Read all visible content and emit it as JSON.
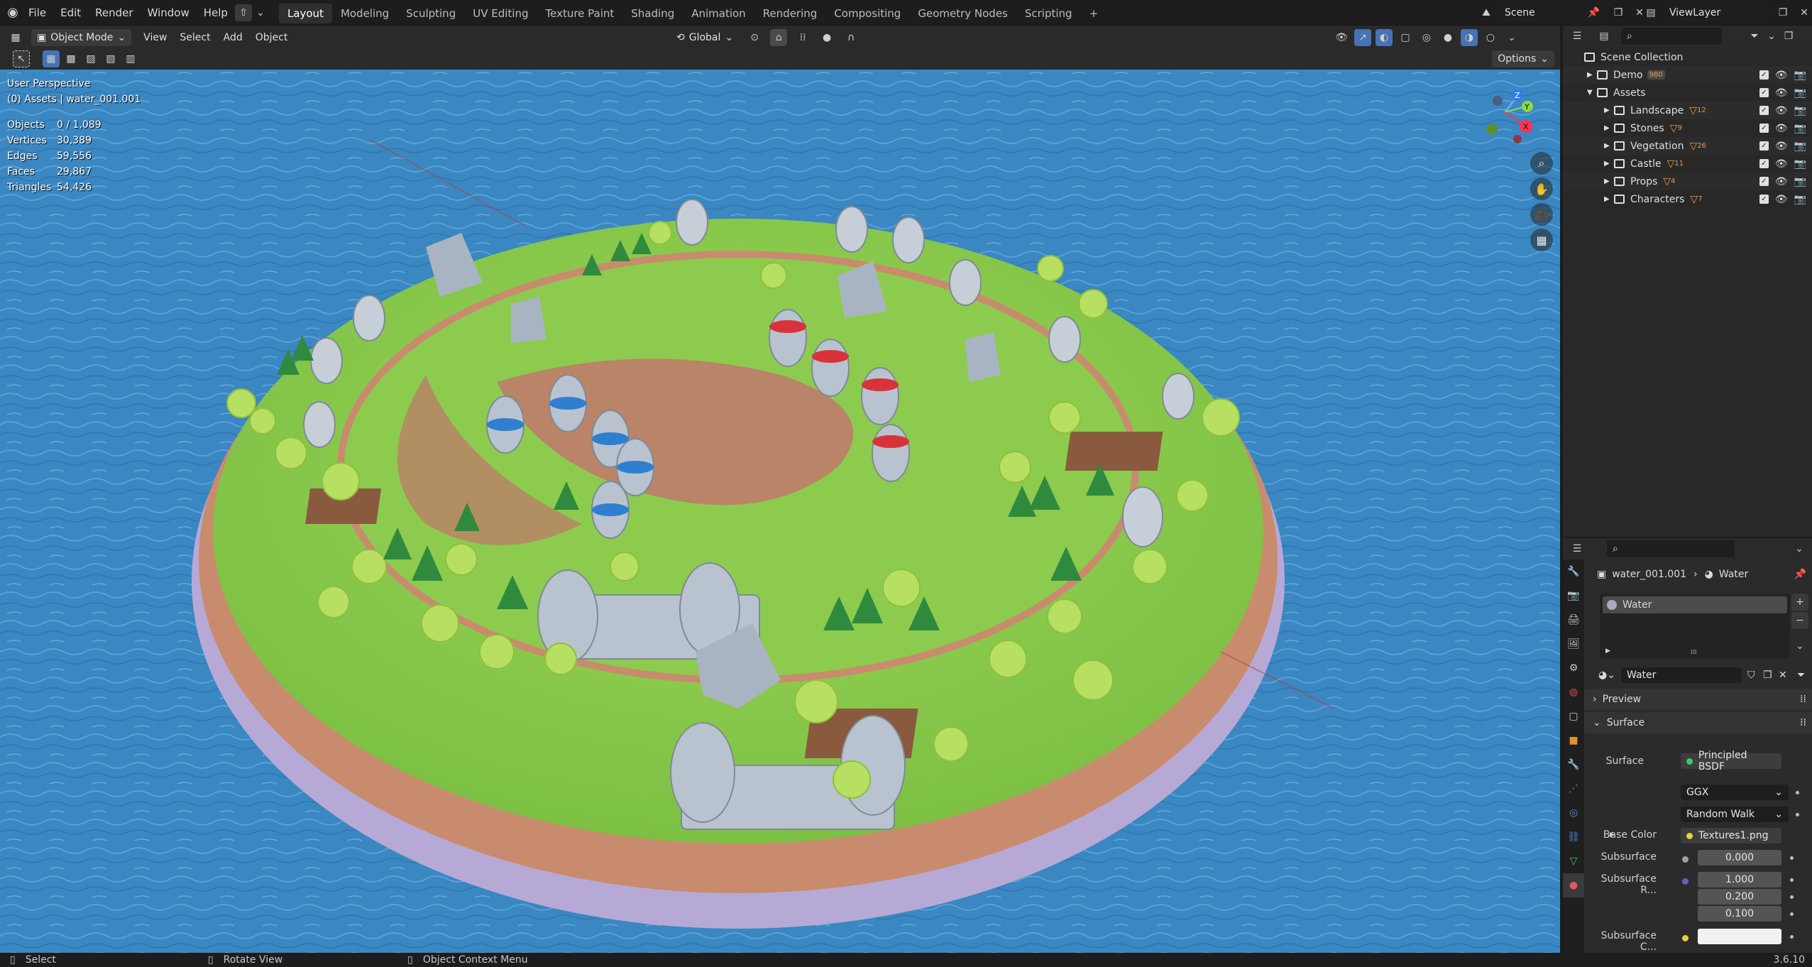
{
  "topbar": {
    "menus": [
      "File",
      "Edit",
      "Render",
      "Window",
      "Help"
    ],
    "workspaces": [
      "Layout",
      "Modeling",
      "Sculpting",
      "UV Editing",
      "Texture Paint",
      "Shading",
      "Animation",
      "Rendering",
      "Compositing",
      "Geometry Nodes",
      "Scripting"
    ],
    "active_workspace": "Layout",
    "add_tab": "+",
    "scene_label": "Scene",
    "viewlayer_label": "ViewLayer"
  },
  "viewport_header": {
    "mode": "Object Mode",
    "menus": [
      "View",
      "Select",
      "Add",
      "Object"
    ],
    "orientation": "Global",
    "options_label": "Options"
  },
  "viewport": {
    "perspective": "User Perspective",
    "active_object": "(0) Assets | water_001.001",
    "stats": [
      {
        "label": "Objects",
        "value": "0 / 1,089"
      },
      {
        "label": "Vertices",
        "value": "30,389"
      },
      {
        "label": "Edges",
        "value": "59,556"
      },
      {
        "label": "Faces",
        "value": "29,867"
      },
      {
        "label": "Triangles",
        "value": "54,426"
      }
    ],
    "gizmo_axes": {
      "x": "X",
      "y": "Y",
      "z": "Z"
    },
    "colors": {
      "water": "#3b86c0",
      "grass": "#8ccb4e",
      "cliff": "#c98b6e",
      "stone": "#b9c3cf",
      "tower_red": "#d8333a",
      "tower_blue": "#2f7fd0"
    }
  },
  "outliner": {
    "root": "Scene Collection",
    "items": [
      {
        "name": "Demo",
        "count": "980",
        "level": 0,
        "expanded": false
      },
      {
        "name": "Assets",
        "count": "",
        "level": 0,
        "expanded": true
      },
      {
        "name": "Landscape",
        "count": "12",
        "level": 1
      },
      {
        "name": "Stones",
        "count": "9",
        "level": 1
      },
      {
        "name": "Vegetation",
        "count": "26",
        "level": 1
      },
      {
        "name": "Castle",
        "count": "11",
        "level": 1
      },
      {
        "name": "Props",
        "count": "4",
        "level": 1
      },
      {
        "name": "Characters",
        "count": "7",
        "level": 1
      }
    ]
  },
  "properties": {
    "breadcrumb_object": "water_001.001",
    "breadcrumb_material": "Water",
    "slot_name": "Water",
    "material_name": "Water",
    "panels": {
      "preview": "Preview",
      "surface": "Surface"
    },
    "surface": {
      "surface_label": "Surface",
      "surface_value": "Principled BSDF",
      "distribution": "GGX",
      "subsurface_method": "Random Walk",
      "base_color_label": "Base Color",
      "base_color_value": "Textures1.png",
      "subsurface_label": "Subsurface",
      "subsurface_value": "0.000",
      "subsurface_radius_label": "Subsurface R...",
      "subsurface_radius": [
        "1.000",
        "0.200",
        "0.100"
      ],
      "subsurface_color_label": "Subsurface C..."
    }
  },
  "statusbar": {
    "select": "Select",
    "rotate": "Rotate View",
    "context": "Object Context Menu",
    "version": "3.6.10"
  }
}
